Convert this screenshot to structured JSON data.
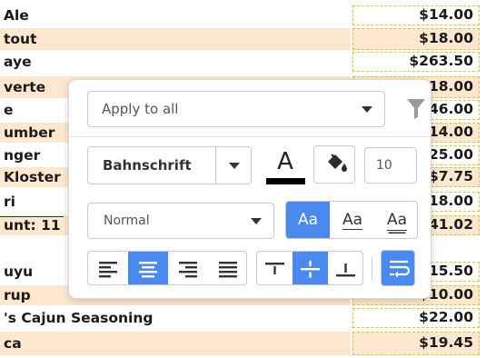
{
  "sheet": {
    "rows": [
      {
        "left": " Ale",
        "right": "$14.00",
        "band": false
      },
      {
        "left": "tout",
        "right": "$18.00",
        "band": true
      },
      {
        "left": "aye",
        "right": "$263.50",
        "band": false
      },
      {
        "left": " verte",
        "right": "$18.00",
        "band": true
      },
      {
        "left": "e",
        "right": "$46.00",
        "band": false
      },
      {
        "left": "umber",
        "right": "$14.00",
        "band": true
      },
      {
        "left": "nger",
        "right": "$25.00",
        "band": false
      },
      {
        "left": "Kloster",
        "right": "$7.75",
        "band": true
      },
      {
        "left": "ri",
        "right": "$18.00",
        "band": false
      },
      {
        "left": "unt: 11",
        "right": "$41.02",
        "band": true
      },
      {
        "left": "",
        "right": "",
        "band": false
      },
      {
        "left": "uyu",
        "right": "$15.50",
        "band": false
      },
      {
        "left": "rup",
        "right": "$10.00",
        "band": true
      },
      {
        "left": "'s Cajun Seasoning",
        "right": "$22.00",
        "band": false
      },
      {
        "left": "ca",
        "right": "$19.45",
        "band": true
      }
    ]
  },
  "popover": {
    "apply_scope": "Apply to all",
    "filter_icon": "filter-icon",
    "font_family": "Bahnschrift",
    "text_color_letter": "A",
    "text_color": "#000000",
    "fill_icon": "paint-bucket-icon",
    "font_size": "10",
    "text_style": "Normal",
    "case_options": [
      {
        "label": "Aa",
        "active": true
      },
      {
        "label": "Aa",
        "active": false
      },
      {
        "label": "Aa",
        "active": false
      }
    ],
    "horizontal_align": {
      "options": [
        "align-left-icon",
        "align-center-icon",
        "align-right-icon",
        "align-justify-icon"
      ],
      "selected": "align-center-icon"
    },
    "vertical_align": {
      "options": [
        "align-top-icon",
        "align-middle-icon",
        "align-bottom-icon"
      ],
      "selected": "align-middle-icon"
    },
    "wrap_text_active": true,
    "accent_color": "#4a89f0"
  }
}
